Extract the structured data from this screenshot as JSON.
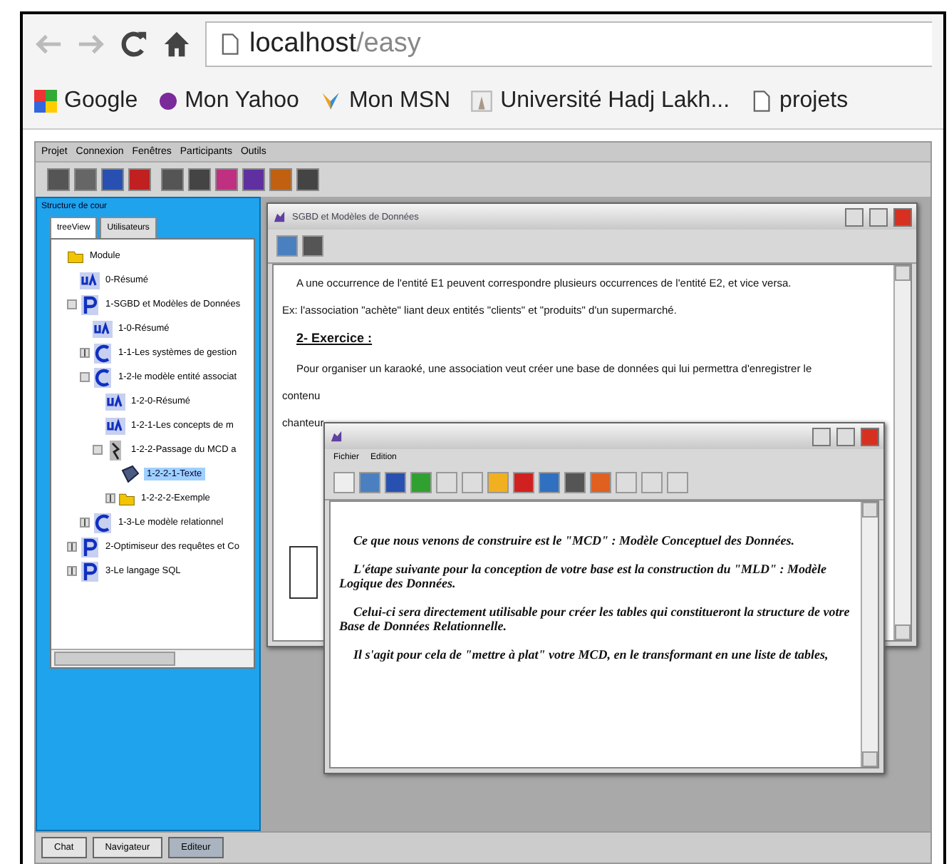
{
  "browser": {
    "address_host": "localhost",
    "address_path": "/easy",
    "bookmarks": [
      {
        "label": "Google",
        "kind": "google"
      },
      {
        "label": "Mon Yahoo",
        "kind": "yahoo"
      },
      {
        "label": "Mon MSN",
        "kind": "msn"
      },
      {
        "label": "Université Hadj Lakh...",
        "kind": "site"
      },
      {
        "label": "projets",
        "kind": "page"
      }
    ]
  },
  "app": {
    "menu": [
      "Projet",
      "Connexion",
      "Fenêtres",
      "Participants",
      "Outils"
    ],
    "sidebar": {
      "title": "Structure de cour",
      "tabs": [
        {
          "label": "treeView",
          "selected": true
        },
        {
          "label": "Utilisateurs",
          "selected": false
        }
      ],
      "tree": [
        {
          "label": "Module",
          "kind": "folder",
          "selected": false,
          "children": [
            {
              "label": "0-Résumé",
              "kind": "ua",
              "selected": false
            },
            {
              "label": "1-SGBD et Modèles de Données",
              "kind": "p",
              "expanded": true,
              "selected": false,
              "children": [
                {
                  "label": "1-0-Résumé",
                  "kind": "ua",
                  "selected": false
                },
                {
                  "label": "1-1-Les systèmes de gestion",
                  "kind": "c",
                  "expanded": false,
                  "selected": false
                },
                {
                  "label": "1-2-le modèle entité associat",
                  "kind": "c",
                  "expanded": true,
                  "selected": false,
                  "children": [
                    {
                      "label": "1-2-0-Résumé",
                      "kind": "ua",
                      "selected": false
                    },
                    {
                      "label": "1-2-1-Les concepts de m",
                      "kind": "ua",
                      "selected": false
                    },
                    {
                      "label": "1-2-2-Passage du MCD a",
                      "kind": "book",
                      "expanded": true,
                      "selected": false,
                      "children": [
                        {
                          "label": "1-2-2-1-Texte",
                          "kind": "text",
                          "selected": true
                        },
                        {
                          "label": "1-2-2-2-Exemple",
                          "kind": "folder",
                          "expanded": false,
                          "selected": false
                        }
                      ]
                    }
                  ]
                },
                {
                  "label": "1-3-Le modèle relationnel",
                  "kind": "c",
                  "expanded": false,
                  "selected": false
                }
              ]
            },
            {
              "label": "2-Optimiseur des requêtes et Co",
              "kind": "p",
              "expanded": false,
              "selected": false
            },
            {
              "label": "3-Le langage SQL",
              "kind": "p",
              "expanded": false,
              "selected": false
            }
          ]
        }
      ]
    },
    "windows": [
      {
        "title": "SGBD et Modèles de Données",
        "paragraphs": [
          {
            "text": "A une occurrence de l'entité E1 peuvent correspondre plusieurs occurrences de l'entité E2, et vice versa.",
            "kind": "indented"
          },
          {
            "text": "Ex: l'association \"achète\" liant deux entités \"clients\" et \"produits\" d'un supermarché.",
            "kind": "plain"
          },
          {
            "text": "2- Exercice :",
            "kind": "heading"
          },
          {
            "text": "Pour organiser un karaoké, une association veut créer une base de données qui lui permettra d'enregistrer le",
            "kind": "indented"
          },
          {
            "text": "contenu",
            "kind": "plain"
          },
          {
            "text": "chanteur",
            "kind": "plain"
          }
        ]
      },
      {
        "menu": [
          "Fichier",
          "Edition"
        ],
        "paragraphs": [
          {
            "text": "Ce que nous venons de construire est le \"MCD\" : Modèle Conceptuel des Données.",
            "kind": "indented"
          },
          {
            "text": "L'étape suivante pour la conception de votre base est la construction du \"MLD\" : Modèle Logique des Données.",
            "kind": "indented"
          },
          {
            "text": "Celui-ci sera directement utilisable pour créer les tables qui constitueront la structure de votre Base de Données Relationnelle.",
            "kind": "indented"
          },
          {
            "text": "Il s'agit pour cela de \"mettre à plat\" votre MCD, en le transformant en une liste de tables,",
            "kind": "indented"
          }
        ]
      }
    ],
    "bottom_tabs": [
      {
        "label": "Chat",
        "selected": false
      },
      {
        "label": "Navigateur",
        "selected": false
      },
      {
        "label": "Editeur",
        "selected": true
      }
    ]
  }
}
